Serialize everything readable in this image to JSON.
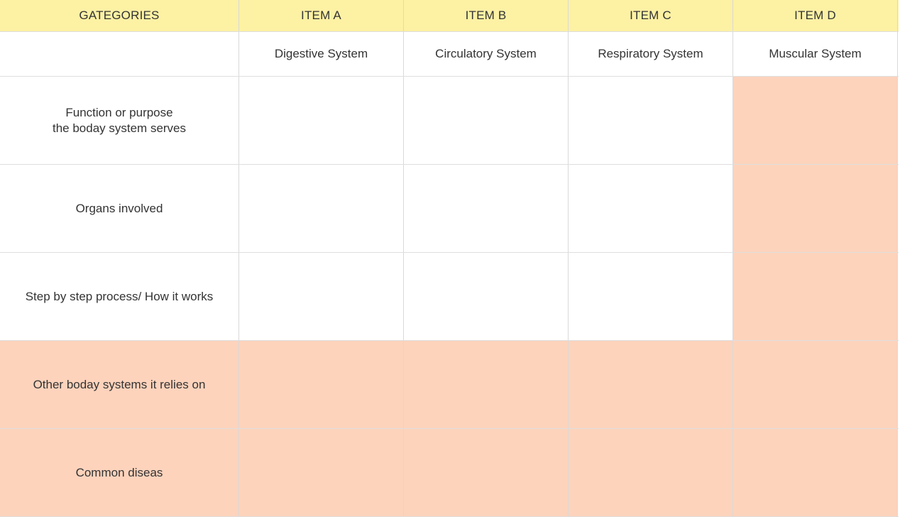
{
  "colors": {
    "header_bg": "#fdf1a4",
    "highlight_bg": "#fdd3bc",
    "white_bg": "#ffffff",
    "grid_line": "#d9d9d9",
    "text": "#333333"
  },
  "header": {
    "columns": [
      "GATEGORIES",
      "ITEM A",
      "ITEM B",
      "ITEM C",
      "ITEM D"
    ]
  },
  "subheader": {
    "cells": [
      "",
      "Digestive System",
      "Circulatory System",
      "Respiratory System",
      "Muscular System"
    ]
  },
  "rows": [
    {
      "label": "Function or purpose\nthe boday system serves",
      "cells": [
        "",
        "",
        "",
        ""
      ],
      "highlight": [
        false,
        false,
        false,
        false,
        true
      ]
    },
    {
      "label": "Organs involved",
      "cells": [
        "",
        "",
        "",
        ""
      ],
      "highlight": [
        false,
        false,
        false,
        false,
        true
      ]
    },
    {
      "label": "Step by step process/ How it works",
      "cells": [
        "",
        "",
        "",
        ""
      ],
      "highlight": [
        false,
        false,
        false,
        false,
        true
      ]
    },
    {
      "label": "Other boday systems it relies on",
      "cells": [
        "",
        "",
        "",
        ""
      ],
      "highlight": [
        true,
        true,
        true,
        true,
        true
      ]
    },
    {
      "label": "Common diseas",
      "cells": [
        "",
        "",
        "",
        ""
      ],
      "highlight": [
        true,
        true,
        true,
        true,
        true
      ]
    }
  ]
}
